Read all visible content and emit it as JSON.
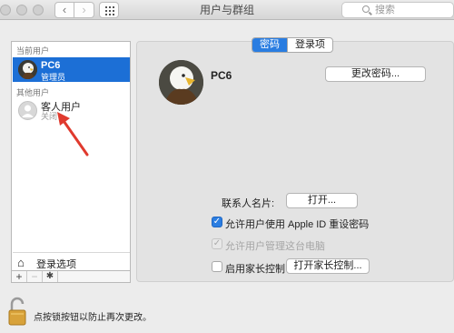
{
  "window": {
    "title": "用户与群组"
  },
  "search": {
    "placeholder": "搜索"
  },
  "sidebar": {
    "current_label": "当前用户",
    "other_label": "其他用户",
    "current_user": {
      "name": "PC6",
      "role": "管理员"
    },
    "guest_user": {
      "name": "客人用户",
      "status": "关闭"
    },
    "login_options": "登录选项",
    "add": "+",
    "remove": "−",
    "gear": "✱"
  },
  "tabs": [
    "密码",
    "登录项"
  ],
  "detail": {
    "name": "PC6",
    "change_password": "更改密码...",
    "contact_card_label": "联系人名片:",
    "open_button": "打开...",
    "allow_reset": "允许用户使用 Apple ID 重设密码",
    "allow_admin": "允许用户管理这台电脑",
    "parental": "启用家长控制",
    "open_parental": "打开家长控制..."
  },
  "lock": {
    "text": "点按锁按钮以防止再次更改。"
  },
  "colors": {
    "accent": "#1c6fd6",
    "arrow": "#e03a2e"
  }
}
